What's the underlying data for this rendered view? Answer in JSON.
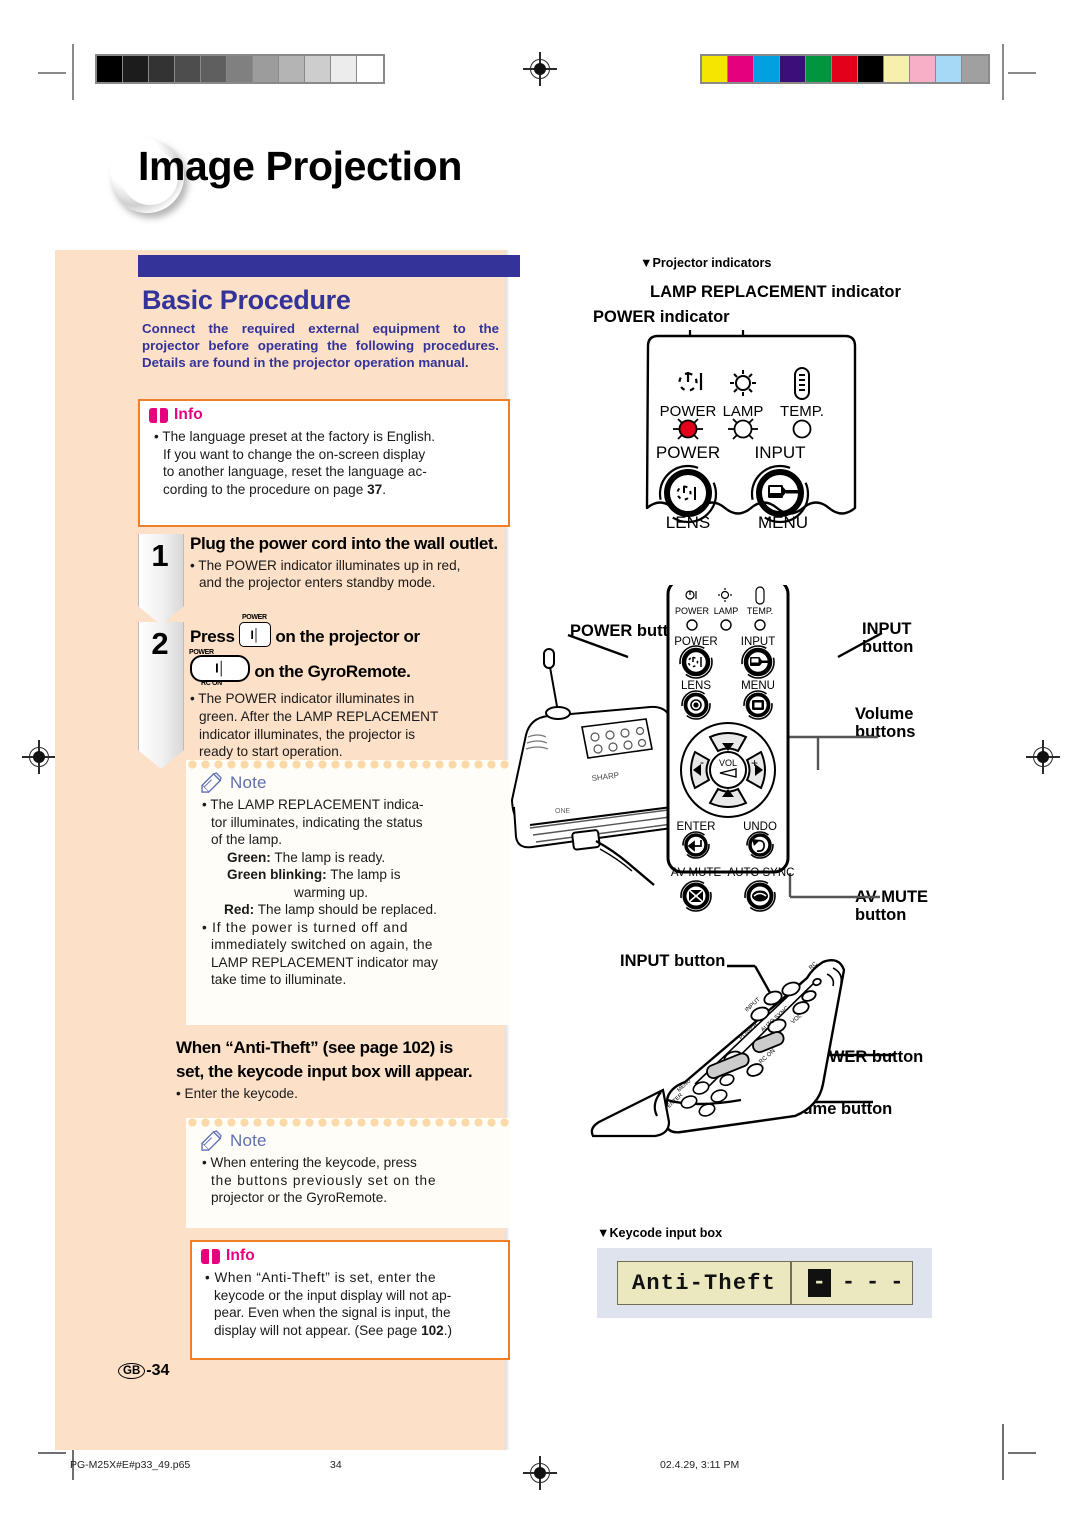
{
  "page": {
    "title": "Image Projection",
    "folio_region": "GB",
    "folio_number": "-34"
  },
  "section": {
    "title": "Basic Procedure",
    "intro": "Connect the required external equipment to the projector before operating the following procedures. Details are found in the projector operation manual."
  },
  "info_box_1": {
    "label": "Info",
    "icon": "book-icon",
    "lines": [
      "• The language preset at the factory is English.",
      "If you want to change the on-screen display",
      "to another language, reset the language ac-",
      "cording to the procedure on page 37."
    ],
    "page_ref": "37"
  },
  "steps": [
    {
      "number": "1",
      "title": "Plug the power cord into the wall outlet.",
      "body_lines": [
        "• The POWER indicator illuminates up in red,",
        "and the projector enters standby mode."
      ]
    },
    {
      "number": "2",
      "title_part1": "Press",
      "title_part2": "on the projector or",
      "title_part3": "on the GyroRemote.",
      "icon_projector_label": "POWER",
      "icon_remote_label_top": "POWER",
      "icon_remote_label_bottom": "RC ON",
      "body_lines": [
        "• The POWER indicator illuminates in",
        "green. After the LAMP REPLACEMENT",
        "indicator illuminates, the projector is",
        "ready to start operation."
      ]
    }
  ],
  "note_box_1": {
    "label": "Note",
    "icon": "pencil-icon",
    "lines": [
      "• The LAMP REPLACEMENT indica-",
      "tor illuminates, indicating the status",
      "of the lamp."
    ],
    "status_list": [
      {
        "term": "Green:",
        "desc": "The lamp is ready."
      },
      {
        "term": "Green blinking:",
        "desc": "The lamp is"
      },
      {
        "term": "",
        "desc": "warming up."
      },
      {
        "term": "Red:",
        "desc": "The lamp should be replaced."
      }
    ],
    "lines2": [
      "• If the power is turned off and",
      "immediately switched on again, the",
      "LAMP REPLACEMENT indicator may",
      "take time to illuminate."
    ]
  },
  "antitheft": {
    "heading_line1": "When “Anti-Theft” (see page 102) is",
    "heading_line2": "set, the keycode input box will appear.",
    "bullet": "• Enter the keycode.",
    "page_ref": "102"
  },
  "note_box_2": {
    "label": "Note",
    "icon": "pencil-icon",
    "lines": [
      "• When entering the keycode, press",
      "the buttons previously set on the",
      "projector or the GyroRemote."
    ]
  },
  "info_box_2": {
    "label": "Info",
    "icon": "book-icon",
    "lines": [
      "• When “Anti-Theft” is set, enter the",
      "keycode or the input display will not ap-",
      "pear. Even when the signal is input, the",
      "display will not appear. (See page 102.)"
    ],
    "page_ref": "102"
  },
  "figures": {
    "indicators": {
      "caption": "▼Projector indicators",
      "label_lamp": "LAMP REPLACEMENT indicator",
      "label_power": "POWER indicator",
      "panel": {
        "indicator_names": [
          "POWER",
          "LAMP",
          "TEMP."
        ],
        "power_led_color": "#e2001a",
        "buttons": [
          "POWER",
          "INPUT"
        ],
        "bottom_buttons": [
          "LENS",
          "MENU"
        ]
      }
    },
    "projector_panel": {
      "indicator_names": [
        "POWER",
        "LAMP",
        "TEMP."
      ],
      "buttons_row1": [
        "POWER",
        "INPUT"
      ],
      "buttons_row2": [
        "LENS",
        "MENU"
      ],
      "vol_label": "VOL",
      "buttons_row3": [
        "ENTER",
        "UNDO"
      ],
      "buttons_row4": [
        "AV MUTE",
        "AUTO SYNC"
      ]
    },
    "callouts_top": [
      {
        "name": "power-button-callout",
        "text": "POWER button"
      },
      {
        "name": "input-button-callout",
        "text": "INPUT\nbutton"
      },
      {
        "name": "volume-buttons-callout",
        "text": "Volume\nbuttons"
      },
      {
        "name": "av-mute-button-callout",
        "text": "AV MUTE\nbutton"
      }
    ],
    "callouts_remote": [
      {
        "name": "input-button-callout",
        "text": "INPUT button"
      },
      {
        "name": "power-button-callout",
        "text": "POWER button"
      },
      {
        "name": "volume-button-callout",
        "text": "Volume button"
      }
    ]
  },
  "keycode_box": {
    "caption": "▼Keycode input box",
    "label": "Anti-Theft",
    "slots": [
      "-",
      "-",
      "-",
      "-"
    ],
    "active_index": 0
  },
  "footer": {
    "filename": "PG-M25X#E#p33_49.p65",
    "page": "34",
    "timestamp": "02.4.29, 3:11 PM"
  },
  "calibration": {
    "gray_steps": [
      "#000000",
      "#1c1c1c",
      "#333333",
      "#4d4d4d",
      "#5f5f5f",
      "#808080",
      "#9c9c9c",
      "#b4b4b4",
      "#cdcdcd",
      "#ececec",
      "#ffffff"
    ],
    "color_bars": [
      "#f5e500",
      "#e5007d",
      "#00a0e1",
      "#3b0f7a",
      "#00953f",
      "#e3001b",
      "#000000",
      "#f7f0ac",
      "#f7aec7",
      "#a6d9f5",
      "#a0a0a0"
    ]
  }
}
